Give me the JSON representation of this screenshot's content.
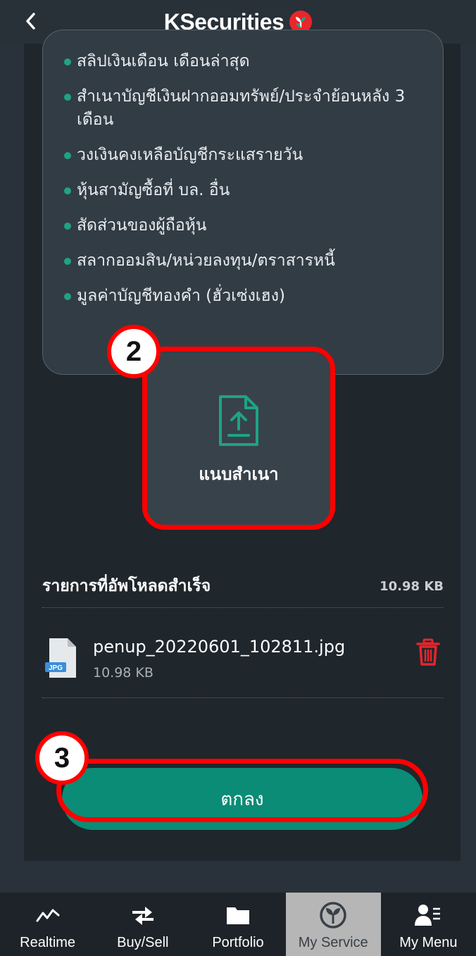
{
  "header": {
    "title": "KSecurities",
    "back_icon": "chevron-left-icon",
    "logo_icon": "kbank-logo"
  },
  "documents": {
    "items": [
      "สลิปเงินเดือน เดือนล่าสุด",
      "สำเนาบัญชีเงินฝากออมทรัพย์/ประจำย้อนหลัง 3 เดือน",
      "วงเงินคงเหลือบัญชีกระแสรายวัน",
      "หุ้นสามัญซื้อที่ บล. อื่น",
      "สัดส่วนของผู้ถือหุ้น",
      "สลากออมสิน/หน่วยลงทุน/ตราสารหนี้",
      "มูลค่าบัญชีทองคำ (ฮั่วเซ่งเฮง)"
    ]
  },
  "upload": {
    "label": "แนบสำเนา",
    "icon": "file-upload-icon"
  },
  "steps": {
    "upload_step": "2",
    "confirm_step": "3"
  },
  "uploaded": {
    "title": "รายการที่อัพโหลดสำเร็จ",
    "total_size": "10.98 KB",
    "files": [
      {
        "name": "penup_20220601_102811.jpg",
        "size": "10.98 KB",
        "type": "JPG"
      }
    ]
  },
  "confirm_button": {
    "label": "ตกลง"
  },
  "bottom_nav": {
    "items": [
      {
        "label": "Realtime",
        "icon": "realtime-chart-icon",
        "active": false
      },
      {
        "label": "Buy/Sell",
        "icon": "buy-sell-arrows-icon",
        "active": false
      },
      {
        "label": "Portfolio",
        "icon": "folder-icon",
        "active": false
      },
      {
        "label": "My Service",
        "icon": "my-service-icon",
        "active": true
      },
      {
        "label": "My Menu",
        "icon": "user-menu-icon",
        "active": false
      }
    ]
  },
  "colors": {
    "accent": "#0a8c76",
    "bullet": "#1ea386",
    "highlight": "#ff0000",
    "delete": "#e3262c"
  }
}
